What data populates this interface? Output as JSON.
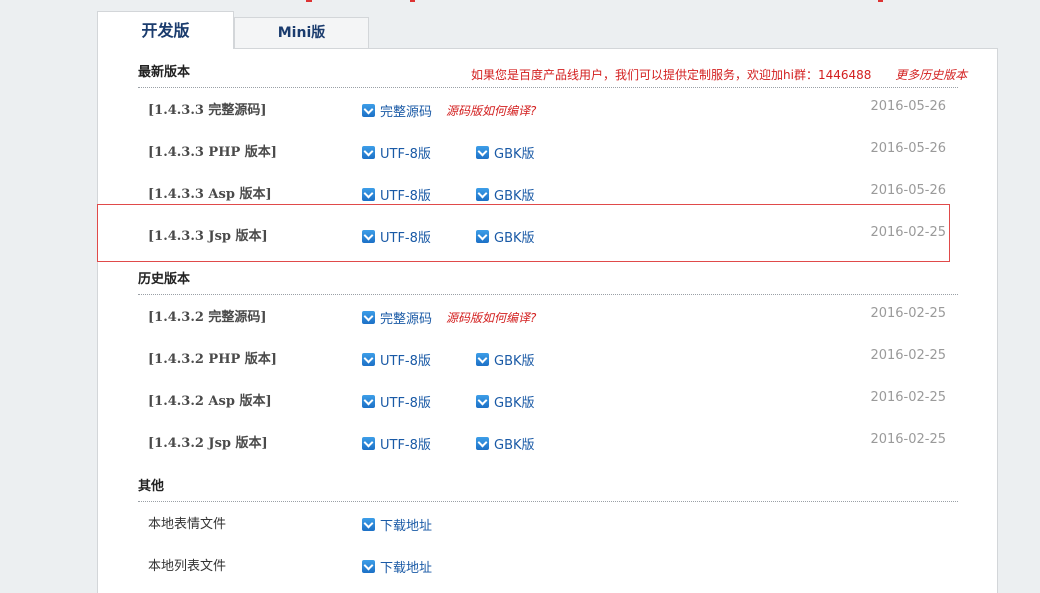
{
  "tabs": {
    "dev": "开发版",
    "mini": "Mini版"
  },
  "sections": {
    "latest": "最新版本",
    "history": "历史版本",
    "other": "其他"
  },
  "notice": {
    "text": "如果您是百度产品线用户，我们可以提供定制服务，欢迎加hi群：1446488",
    "more": "更多历史版本"
  },
  "latest_rows": [
    {
      "name": "[1.4.3.3 完整源码]",
      "link1": "完整源码",
      "hint": "源码版如何编译?",
      "date": "2016-05-26"
    },
    {
      "name": "[1.4.3.3 PHP 版本]",
      "link1": "UTF-8版",
      "link2": "GBK版",
      "date": "2016-05-26"
    },
    {
      "name": "[1.4.3.3 Asp 版本]",
      "link1": "UTF-8版",
      "link2": "GBK版",
      "date": "2016-05-26"
    },
    {
      "name": "[1.4.3.3 Jsp 版本]",
      "link1": "UTF-8版",
      "link2": "GBK版",
      "date": "2016-02-25"
    }
  ],
  "history_rows": [
    {
      "name": "[1.4.3.2 完整源码]",
      "link1": "完整源码",
      "hint": "源码版如何编译?",
      "date": "2016-02-25"
    },
    {
      "name": "[1.4.3.2 PHP 版本]",
      "link1": "UTF-8版",
      "link2": "GBK版",
      "date": "2016-02-25"
    },
    {
      "name": "[1.4.3.2 Asp 版本]",
      "link1": "UTF-8版",
      "link2": "GBK版",
      "date": "2016-02-25"
    },
    {
      "name": "[1.4.3.2 Jsp 版本]",
      "link1": "UTF-8版",
      "link2": "GBK版",
      "date": "2016-02-25"
    }
  ],
  "other_rows": [
    {
      "name": "本地表情文件",
      "link1": "下载地址"
    },
    {
      "name": "本地列表文件",
      "link1": "下载地址"
    }
  ],
  "colors": {
    "accent": "#1a5aa6",
    "notice": "#d32020",
    "highlight": "#e04a4a"
  }
}
